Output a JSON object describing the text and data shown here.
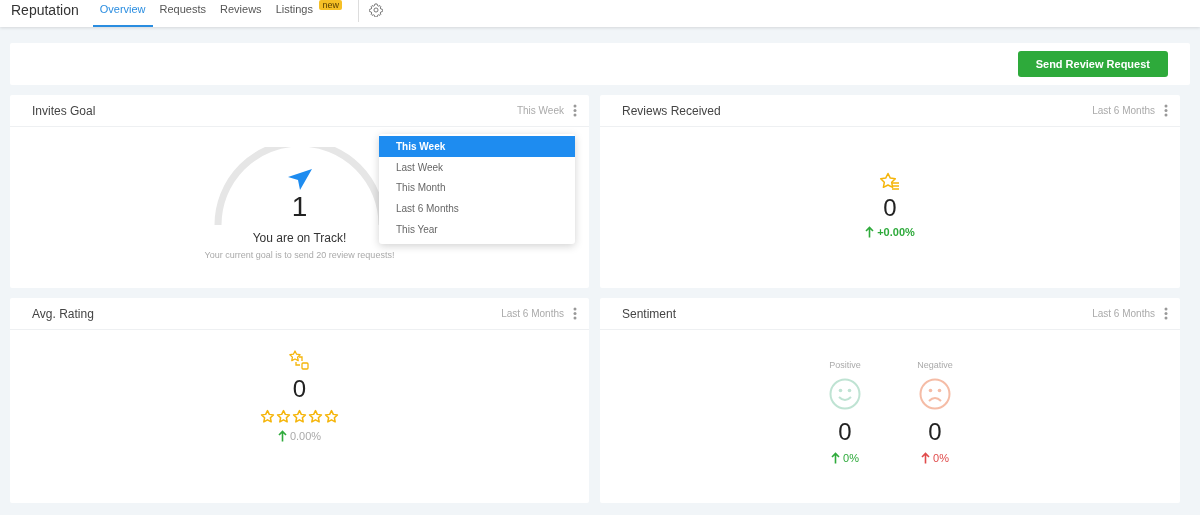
{
  "header": {
    "title": "Reputation",
    "tabs": [
      {
        "label": "Overview",
        "selected": true
      },
      {
        "label": "Requests",
        "selected": false
      },
      {
        "label": "Reviews",
        "selected": false
      },
      {
        "label": "Listings",
        "selected": false,
        "badge": "new"
      }
    ]
  },
  "action_button": "Send Review Request",
  "cards": [
    {
      "kind": "goal",
      "title": "Invites Goal",
      "period": "This Week",
      "value": "1",
      "status": "You are on Track!",
      "note": "Your current goal is to send 20 review requests!",
      "dropdown": [
        {
          "label": "This Week",
          "selected": true
        },
        {
          "label": "Last Week",
          "selected": false
        },
        {
          "label": "This Month",
          "selected": false
        },
        {
          "label": "Last 6 Months",
          "selected": false
        },
        {
          "label": "This Year",
          "selected": false
        }
      ]
    },
    {
      "kind": "reviews",
      "title": "Reviews Received",
      "period": "Last 6 Months",
      "value": "0",
      "change": "+0.00%"
    },
    {
      "kind": "rating",
      "title": "Avg. Rating",
      "period": "Last 6 Months",
      "value": "0",
      "stars": 0,
      "change": "0.00%"
    },
    {
      "kind": "sentiment",
      "title": "Sentiment",
      "period": "Last 6 Months",
      "items": [
        {
          "kind": "positive",
          "label": "Positive",
          "value": "0",
          "change": "0%"
        },
        {
          "kind": "negative",
          "label": "Negative",
          "value": "0",
          "change": "0%"
        }
      ]
    }
  ]
}
